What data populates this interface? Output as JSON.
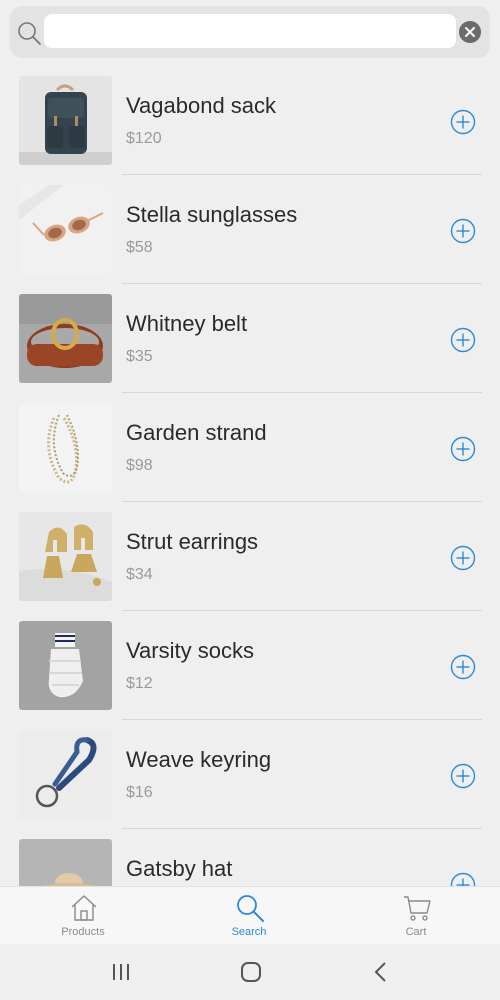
{
  "search": {
    "value": "",
    "placeholder": ""
  },
  "products": [
    {
      "name": "Vagabond sack",
      "price": "$120",
      "thumb": "backpack"
    },
    {
      "name": "Stella sunglasses",
      "price": "$58",
      "thumb": "sunglasses"
    },
    {
      "name": "Whitney belt",
      "price": "$35",
      "thumb": "belt"
    },
    {
      "name": "Garden strand",
      "price": "$98",
      "thumb": "necklace"
    },
    {
      "name": "Strut earrings",
      "price": "$34",
      "thumb": "earrings"
    },
    {
      "name": "Varsity socks",
      "price": "$12",
      "thumb": "socks"
    },
    {
      "name": "Weave keyring",
      "price": "$16",
      "thumb": "keyring"
    },
    {
      "name": "Gatsby hat",
      "price": "",
      "thumb": "hat"
    }
  ],
  "tabs": [
    {
      "label": "Products",
      "icon": "home-icon"
    },
    {
      "label": "Search",
      "icon": "search-icon"
    },
    {
      "label": "Cart",
      "icon": "cart-icon"
    }
  ],
  "colors": {
    "accent": "#2b8ad8",
    "background": "#efefef",
    "price": "#9a9a9a"
  }
}
